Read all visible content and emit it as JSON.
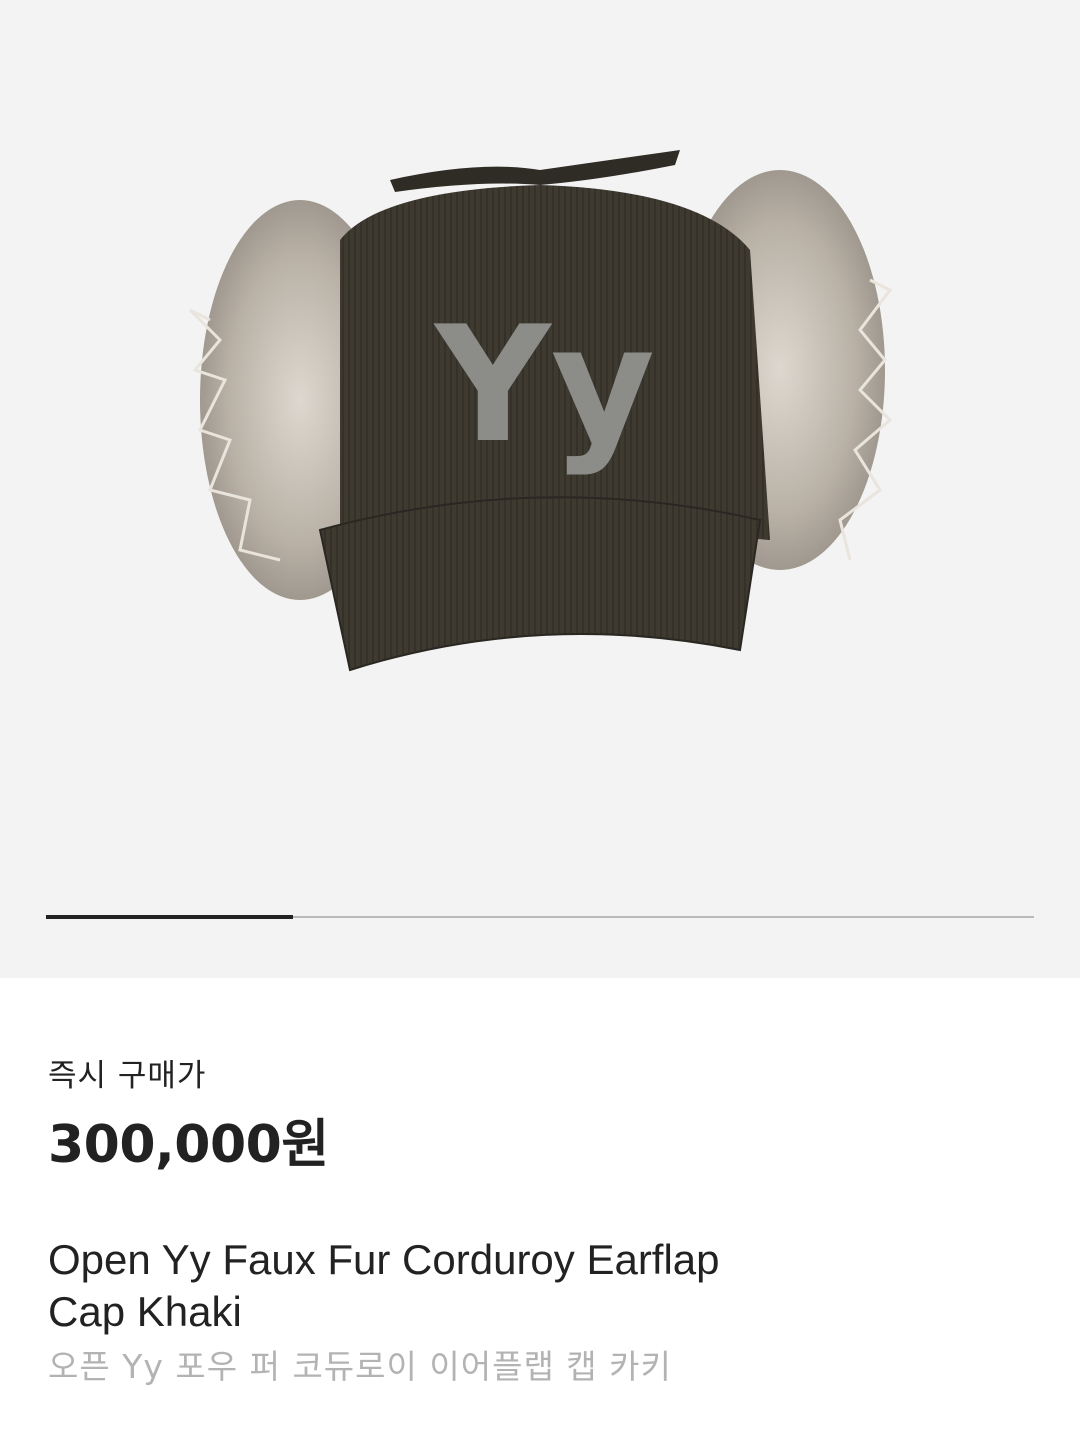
{
  "gallery": {
    "image_alt": "Yy",
    "image_logo_text": "Yy",
    "page_progress": 0.25
  },
  "colors": {
    "gallery_bg": "#f3f3f3",
    "cap_body": "#3e3a30",
    "fur": "#c8c1b6",
    "logo": "#8c8c88",
    "text_primary": "#222222",
    "text_secondary": "#b3b3b3"
  },
  "product": {
    "price_label": "즉시 구매가",
    "price": "300,000원",
    "name_line1": "Open Yy Faux Fur Corduroy Earflap",
    "name_line2": "Cap Khaki",
    "name_ko": "오픈 Yy 포우 퍼 코듀로이 이어플랩 캡 카키"
  }
}
